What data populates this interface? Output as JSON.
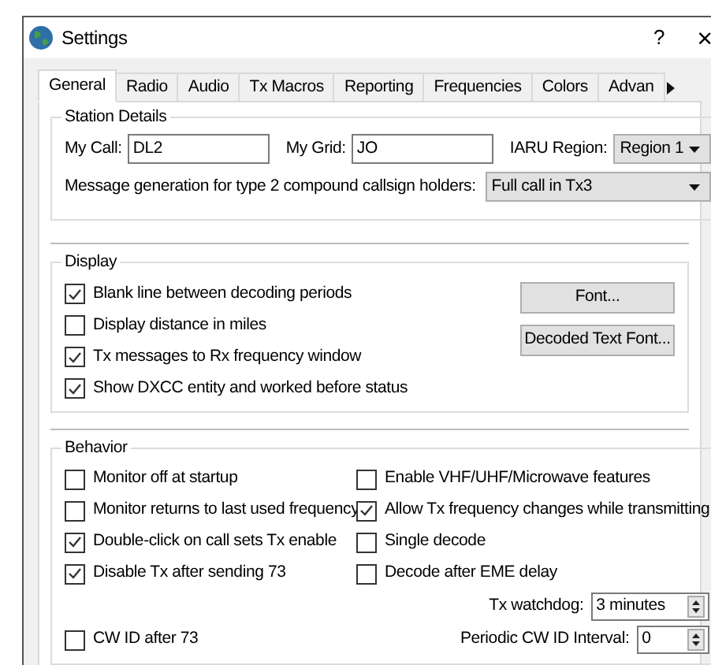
{
  "window": {
    "title": "Settings",
    "help": "?",
    "close": "×"
  },
  "tabs": [
    {
      "label": "General",
      "selected": true
    },
    {
      "label": "Radio",
      "selected": false
    },
    {
      "label": "Audio",
      "selected": false
    },
    {
      "label": "Tx Macros",
      "selected": false
    },
    {
      "label": "Reporting",
      "selected": false
    },
    {
      "label": "Frequencies",
      "selected": false
    },
    {
      "label": "Colors",
      "selected": false
    },
    {
      "label": "Advan",
      "selected": false
    }
  ],
  "station_details": {
    "title": "Station Details",
    "my_call": {
      "label": "My Call:",
      "value": "DL2"
    },
    "my_grid": {
      "label": "My Grid:",
      "value": "JO"
    },
    "iaru_region": {
      "label": "IARU Region:",
      "value": "Region 1"
    },
    "message_generation": {
      "label": "Message generation for type 2 compound callsign holders:",
      "value": "Full call in Tx3"
    }
  },
  "display": {
    "title": "Display",
    "options": [
      {
        "label": "Blank line between decoding periods",
        "checked": true
      },
      {
        "label": "Display distance in miles",
        "checked": false
      },
      {
        "label": "Tx messages to Rx frequency window",
        "checked": true
      },
      {
        "label": "Show DXCC entity and worked before status",
        "checked": true
      }
    ],
    "buttons": [
      "Font...",
      "Decoded Text Font..."
    ]
  },
  "behavior": {
    "title": "Behavior",
    "options": [
      {
        "label": "Monitor off at startup",
        "checked": false
      },
      {
        "label": "Enable VHF/UHF/Microwave features",
        "checked": false
      },
      {
        "label": "Monitor returns to last used frequency",
        "checked": false
      },
      {
        "label": "Allow Tx frequency changes while transmitting",
        "checked": true
      },
      {
        "label": "Double-click on call sets Tx enable",
        "checked": true
      },
      {
        "label": "Single decode",
        "checked": false
      },
      {
        "label": "Disable Tx after sending 73",
        "checked": true
      },
      {
        "label": "Decode after EME delay",
        "checked": false
      }
    ],
    "tx_watchdog": {
      "label": "Tx watchdog:",
      "value": "3 minutes"
    },
    "cw_id": {
      "label": "CW ID after 73",
      "checked": false
    },
    "periodic_cw_id": {
      "label": "Periodic CW ID Interval:",
      "value": "0"
    }
  }
}
